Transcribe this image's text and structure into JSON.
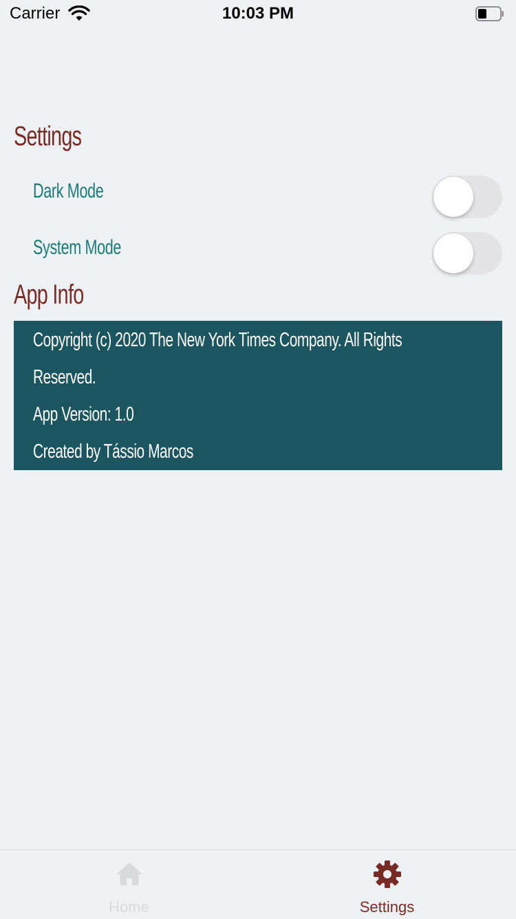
{
  "status_bar": {
    "carrier": "Carrier",
    "time": "10:03 PM",
    "wifi_icon": "wifi-icon",
    "battery_icon": "battery-icon"
  },
  "settings": {
    "title": "Settings",
    "items": [
      {
        "label": "Dark Mode",
        "enabled": false
      },
      {
        "label": "System Mode",
        "enabled": false
      }
    ]
  },
  "app_info": {
    "title": "App Info",
    "lines": [
      "Copyright (c) 2020 The New York Times Company. All Rights",
      "Reserved.",
      "App Version: 1.0",
      "Created by Tássio Marcos"
    ]
  },
  "tab_bar": {
    "tabs": [
      {
        "label": "Home",
        "icon": "home-icon",
        "active": false
      },
      {
        "label": "Settings",
        "icon": "gear-icon",
        "active": true
      }
    ]
  },
  "colors": {
    "background": "#eff2f5",
    "title": "#7a2a24",
    "setting_label": "#1b7a78",
    "info_box": "#1b5560",
    "tab_active": "#7a2a24",
    "tab_inactive": "#d8dadd"
  }
}
